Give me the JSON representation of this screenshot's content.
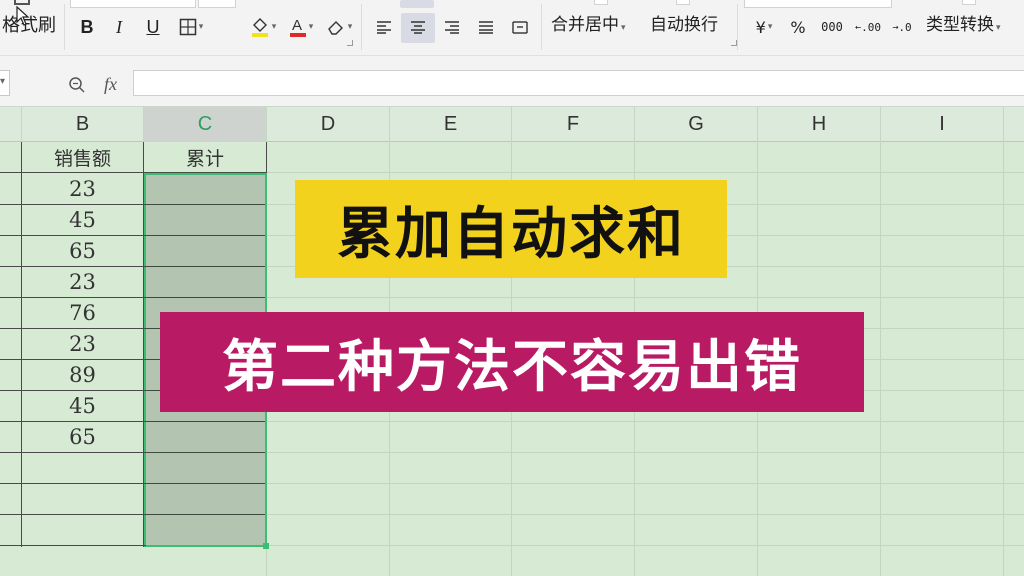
{
  "ribbon": {
    "format_painter_label": "格式刷",
    "bold_label": "B",
    "italic_label": "I",
    "underline_label": "U",
    "merge_center_label": "合并居中",
    "wrap_text_label": "自动换行",
    "currency_label": "¥",
    "percent_label": "%",
    "thousands_label": "000",
    "inc_decimal_label": ".00",
    "dec_decimal_label": ".0",
    "type_convert_label": "类型转换",
    "icons": [
      "format-painter-icon",
      "borders-icon",
      "fill-color-icon",
      "font-color-icon",
      "clear-format-icon",
      "align-left-icon",
      "align-center-icon",
      "align-right-icon",
      "justify-icon",
      "distributed-icon"
    ]
  },
  "formula_bar": {
    "zoom_icon": "zoom-icon",
    "fx_label": "fx",
    "value": ""
  },
  "columns": [
    "B",
    "C",
    "D",
    "E",
    "F",
    "G",
    "H",
    "I"
  ],
  "active_column": "C",
  "sheet": {
    "header_b": "销售额",
    "header_c": "累计",
    "sales": [
      "23",
      "45",
      "65",
      "23",
      "76",
      "23",
      "89",
      "45",
      "65"
    ],
    "cumulative": []
  },
  "overlay": {
    "title": "累加自动求和",
    "subtitle": "第二种方法不容易出错",
    "title_bg": "#f2d21d",
    "subtitle_bg": "#b81a63"
  },
  "colors": {
    "grid_bg": "#d6ead4",
    "selection_border": "#3cbd73",
    "selection_fill": "#b3c4b1"
  }
}
